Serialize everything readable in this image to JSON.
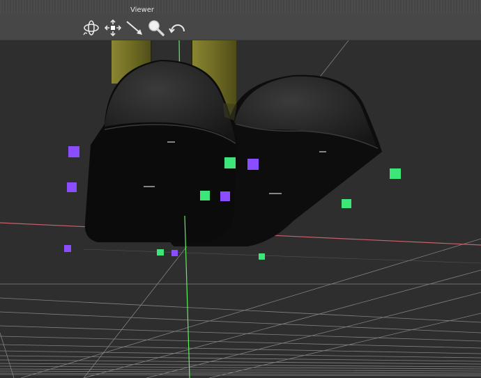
{
  "panel": {
    "title": "Viewer"
  },
  "toolbar": {
    "tools": [
      {
        "name": "orbit",
        "icon": "orbit-icon"
      },
      {
        "name": "pan",
        "icon": "pan-move-icon"
      },
      {
        "name": "dolly",
        "icon": "dolly-arrow-icon"
      },
      {
        "name": "zoom",
        "icon": "zoom-magnifier-icon"
      },
      {
        "name": "undo-view",
        "icon": "undo-arc-icon"
      }
    ]
  },
  "colors": {
    "panel_bg": "#474747",
    "viewport_bg": "#2e2e2e",
    "x_axis": "#c8626b",
    "y_axis": "#5ef05e",
    "grid": "#8c8c8c",
    "marker_green": "#3ce678",
    "marker_purple": "#8040ff",
    "boot": "#1c1c1c",
    "leg": "#7d7a2c"
  },
  "scene": {
    "objects": [
      "left-boot",
      "right-boot",
      "left-leg",
      "right-leg"
    ],
    "markers": [
      "purple-marker",
      "green-marker"
    ]
  }
}
